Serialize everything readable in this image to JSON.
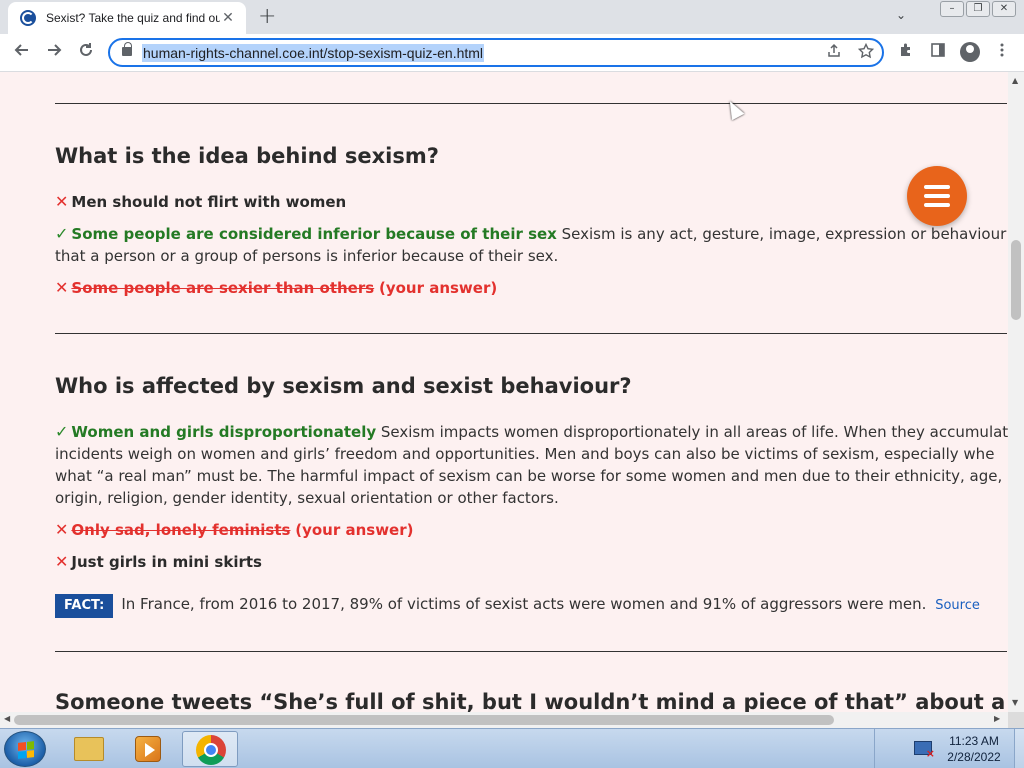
{
  "browser": {
    "tab_title": "Sexist? Take the quiz and find out!",
    "tab_close": "✕",
    "new_tab": "+",
    "tab_search": "⌄",
    "window_controls": [
      "–",
      "❐",
      "✕"
    ],
    "url": "human-rights-channel.coe.int/stop-sexism-quiz-en.html",
    "icons": [
      "back-icon",
      "forward-icon",
      "reload-icon",
      "lock-icon",
      "share-icon",
      "star-icon",
      "extensions-icon",
      "side-panel-icon",
      "profile-icon",
      "more-icon"
    ]
  },
  "quiz": {
    "q1": {
      "title": "What is the idea behind sexism?",
      "answers": [
        {
          "text": "Men should not flirt with women",
          "status": "wrong"
        },
        {
          "text": "Some people are considered inferior because of their sex",
          "status": "correct",
          "explanation_line1": "Sexism is any act, gesture, image, expression or behaviour based",
          "explanation_line2": "that a person or a group of persons is inferior because of their sex."
        },
        {
          "text": "Some people are sexier than others",
          "status": "your-wrong-answer",
          "your_answer": "(your answer)"
        }
      ]
    },
    "q2": {
      "title": "Who is affected by sexism and sexist behaviour?",
      "answers": [
        {
          "text": "Women and girls disproportionately",
          "status": "correct",
          "explanation_line1": "Sexism impacts women disproportionately in all areas of life. When they accumulate c",
          "explanation_line2": "incidents weigh on women and girls’ freedom and opportunities. Men and boys can also be victims of sexism, especially whe",
          "explanation_line3": "what “a real man” must be. The harmful impact of sexism can be worse for some women and men due to their ethnicity, age,",
          "explanation_line4": "origin, religion, gender identity, sexual orientation or other factors."
        },
        {
          "text": "Only sad, lonely feminists",
          "status": "your-wrong-answer",
          "your_answer": "(your answer)"
        },
        {
          "text": "Just girls in mini skirts",
          "status": "wrong"
        }
      ],
      "fact": {
        "label": "FACT:",
        "text": "In France, from 2016 to 2017, 89% of victims of sexist acts were women and 91% of aggressors were men.",
        "source_label": "Source"
      }
    },
    "q3": {
      "title": "Someone tweets “She’s full of shit, but I wouldn’t mind a piece of that” about a woman"
    }
  },
  "marks": {
    "wrong": "✕",
    "correct": "✓"
  },
  "colors": {
    "page_bg": "#fdf1f1",
    "correct": "#247a24",
    "wrong": "#e3312e",
    "fact_bg": "#1a4f9c",
    "menu_button": "#e8641b"
  },
  "taskbar": {
    "clock_time": "11:23 AM",
    "clock_date": "2/28/2022",
    "items": [
      "file-explorer",
      "media-player",
      "chrome"
    ]
  }
}
